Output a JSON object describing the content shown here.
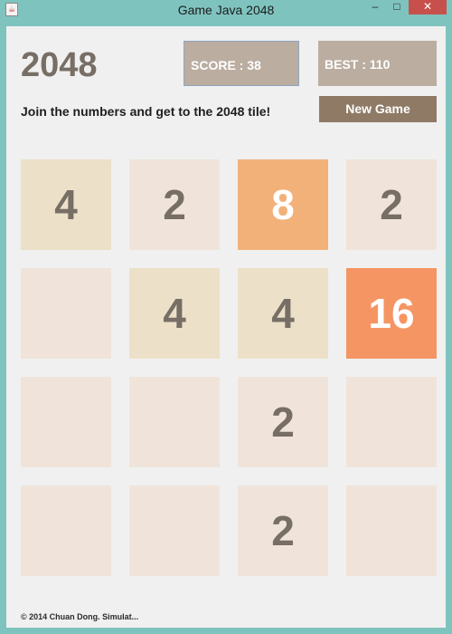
{
  "window": {
    "title": "Game Java 2048",
    "app_icon": "java-cup-icon",
    "controls": {
      "minimize": "–",
      "maximize": "□",
      "close": "✕"
    },
    "titlebar_color": "#7fc3bf",
    "close_color": "#c7504c"
  },
  "header": {
    "logo": "2048",
    "score_label": "SCORE : 38",
    "best_label": "BEST : 110",
    "subtitle": "Join the numbers and get to the 2048 tile!",
    "new_game_label": "New Game"
  },
  "board": {
    "rows": [
      [
        "4",
        "2",
        "8",
        "2"
      ],
      [
        "",
        "4",
        "4",
        "16"
      ],
      [
        "",
        "",
        "2",
        ""
      ],
      [
        "",
        "",
        "2",
        ""
      ]
    ],
    "tile_colors": {
      "empty": "#f0e4da",
      "2": "#f0e4da",
      "4": "#ede0c8",
      "8": "#f2b179",
      "16": "#f59563"
    },
    "text_colors": {
      "dark": "#776e65",
      "light": "#ffffff"
    }
  },
  "footer": {
    "text": "© 2014 Chuan Dong. Simulat..."
  }
}
